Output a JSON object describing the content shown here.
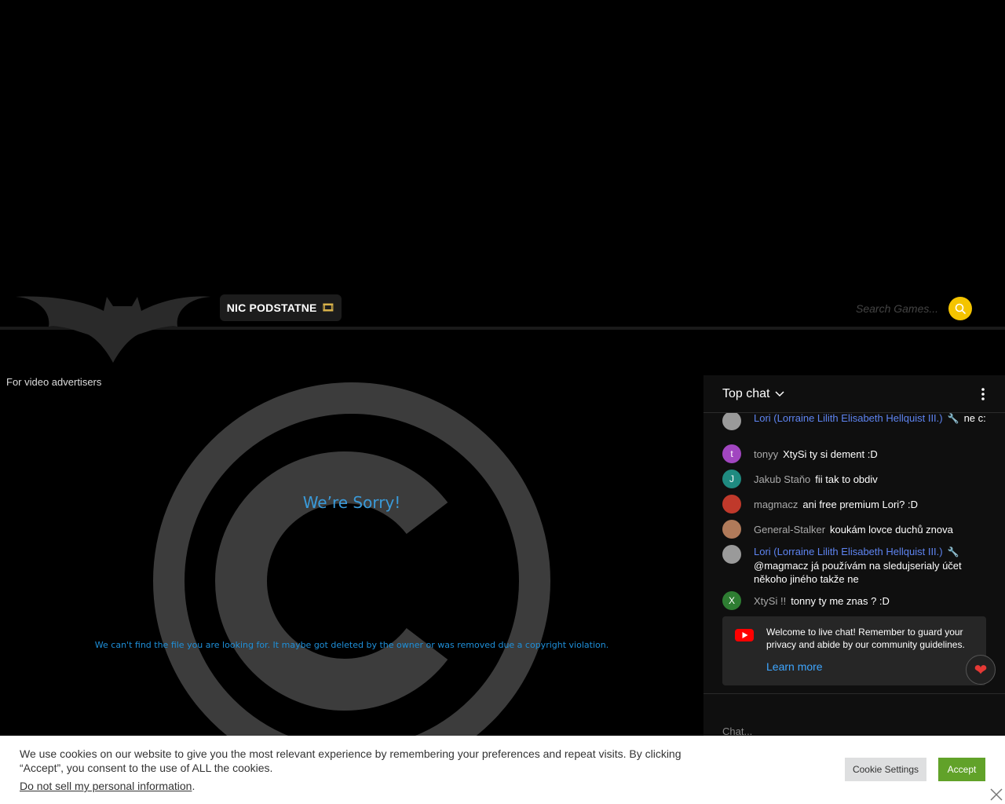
{
  "header": {
    "nav_label": "NIC PODSTATNE",
    "nav_icon": "🎞",
    "search_placeholder": "Search Games..."
  },
  "advert_text": "For video advertisers",
  "error": {
    "title": "We’re Sorry!",
    "message": "We can't find the file you are looking for. It maybe got deleted by the owner or was removed due a copyright violation."
  },
  "chat": {
    "title": "Top chat",
    "messages": [
      {
        "author": "Lori (Lorraine Lilith Elisabeth Hellquist III.)",
        "text": "ne c:",
        "avatar_letter": "",
        "avatar_color": "#9a9a9a",
        "moderator": true
      },
      {
        "author": "tonyy",
        "text": "XtySi ty si dement :D",
        "avatar_letter": "t",
        "avatar_color": "#a146c0",
        "moderator": false
      },
      {
        "author": "Jakub Staňo",
        "text": "fii tak to obdiv",
        "avatar_letter": "J",
        "avatar_color": "#1f8a80",
        "moderator": false
      },
      {
        "author": "magmacz",
        "text": "ani free premium Lori? :D",
        "avatar_letter": "",
        "avatar_color": "#c0392b",
        "moderator": false
      },
      {
        "author": "General-Stalker",
        "text": "koukám lovce duchů znova",
        "avatar_letter": "",
        "avatar_color": "#b07a5a",
        "moderator": false
      },
      {
        "author": "Lori (Lorraine Lilith Elisabeth Hellquist III.)",
        "text": "@magmacz já používám na sledujserialy účet někoho jiného takže ne",
        "avatar_letter": "",
        "avatar_color": "#9a9a9a",
        "moderator": true
      },
      {
        "author": "XtySi !!",
        "text": "tonny ty me znas ? :D",
        "avatar_letter": "X",
        "avatar_color": "#2e7d32",
        "moderator": false
      }
    ],
    "welcome_text": "Welcome to live chat! Remember to guard your privacy and abide by our community guidelines.",
    "learn_more": "Learn more",
    "input_placeholder": "Chat..."
  },
  "cookie": {
    "text": "We use cookies on our website to give you the most relevant experience by remembering your preferences and repeat visits. By clicking “Accept”, you consent to the use of ALL the cookies.",
    "link_text": "Do not sell my personal information",
    "link_suffix": ".",
    "settings_label": "Cookie Settings",
    "accept_label": "Accept"
  }
}
